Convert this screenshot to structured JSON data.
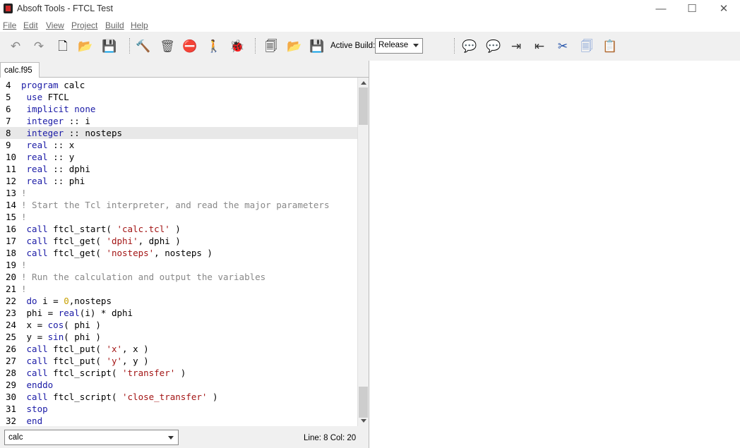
{
  "window": {
    "title": "Absoft Tools - FTCL Test",
    "minimize": "—",
    "maximize": "☐",
    "close": "✕"
  },
  "menu": [
    "File",
    "Edit",
    "View",
    "Project",
    "Build",
    "Help"
  ],
  "toolbar": {
    "active_build_label": "Active Build:",
    "active_build_value": "Release",
    "icons": {
      "undo": "↶",
      "redo": "↷",
      "new": "🗋",
      "open": "📂",
      "save": "💾",
      "build": "🔨",
      "clean": "🗑",
      "stop": "⛔",
      "run": "🚶",
      "debug": "🐞",
      "copy_doc": "🗐",
      "open_doc": "📂",
      "save_all": "💾",
      "comment": "💬",
      "uncomment": "💬",
      "indent": "⇥",
      "outdent": "⇤",
      "cut": "✂",
      "copy": "🗐",
      "paste": "📋"
    }
  },
  "editor": {
    "tab": "calc.f95",
    "lines": [
      {
        "n": "4",
        "code": "program calc"
      },
      {
        "n": "5",
        "code": " use FTCL"
      },
      {
        "n": "6",
        "code": " implicit none"
      },
      {
        "n": "7",
        "code": " integer :: i"
      },
      {
        "n": "8",
        "code": " integer :: nosteps"
      },
      {
        "n": "9",
        "code": " real :: x"
      },
      {
        "n": "10",
        "code": " real :: y"
      },
      {
        "n": "11",
        "code": " real :: dphi"
      },
      {
        "n": "12",
        "code": " real :: phi"
      },
      {
        "n": "13",
        "code": "!"
      },
      {
        "n": "14",
        "code": "! Start the Tcl interpreter, and read the major parameters"
      },
      {
        "n": "15",
        "code": "!"
      },
      {
        "n": "16",
        "code": " call ftcl_start( 'calc.tcl' )"
      },
      {
        "n": "17",
        "code": " call ftcl_get( 'dphi', dphi )"
      },
      {
        "n": "18",
        "code": " call ftcl_get( 'nosteps', nosteps )"
      },
      {
        "n": "19",
        "code": "!"
      },
      {
        "n": "20",
        "code": "! Run the calculation and output the variables"
      },
      {
        "n": "21",
        "code": "!"
      },
      {
        "n": "22",
        "code": " do i = 0,nosteps"
      },
      {
        "n": "23",
        "code": " phi = real(i) * dphi"
      },
      {
        "n": "24",
        "code": " x = cos( phi )"
      },
      {
        "n": "25",
        "code": " y = sin( phi )"
      },
      {
        "n": "26",
        "code": " call ftcl_put( 'x', x )"
      },
      {
        "n": "27",
        "code": " call ftcl_put( 'y', y )"
      },
      {
        "n": "28",
        "code": " call ftcl_script( 'transfer' )"
      },
      {
        "n": "29",
        "code": " enddo"
      },
      {
        "n": "30",
        "code": " call ftcl_script( 'close_transfer' )"
      },
      {
        "n": "31",
        "code": " stop"
      },
      {
        "n": "32",
        "code": " end"
      }
    ],
    "highlighted_line": "8"
  },
  "status": {
    "scope": "calc",
    "cursor": "Line: 8 Col: 20"
  }
}
